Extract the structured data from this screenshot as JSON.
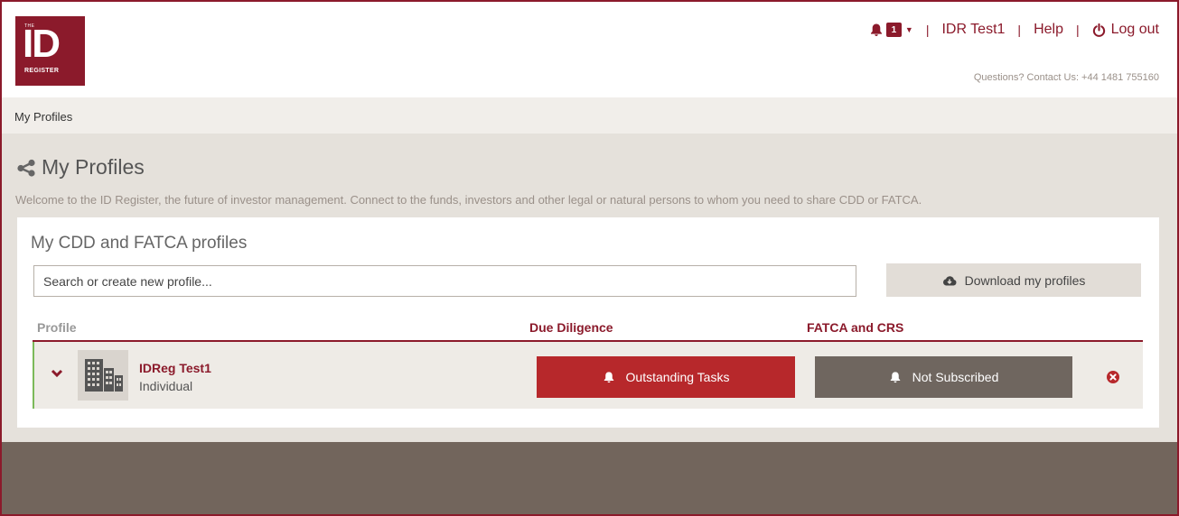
{
  "logo": {
    "the": "THE",
    "id": "ID",
    "register": "REGISTER"
  },
  "topnav": {
    "notification_count": "1",
    "user": "IDR Test1",
    "help": "Help",
    "logout": "Log out",
    "separator": "|"
  },
  "contact": "Questions? Contact Us: +44 1481 755160",
  "breadcrumb": "My Profiles",
  "page": {
    "title": "My Profiles",
    "welcome": "Welcome to the ID Register, the future of investor management. Connect to the funds, investors and other legal or natural persons to whom you need to share CDD or FATCA."
  },
  "card": {
    "title": "My CDD and FATCA profiles",
    "search_placeholder": "Search or create new profile...",
    "download_label": "Download my profiles",
    "columns": {
      "profile": "Profile",
      "due_diligence": "Due Diligence",
      "fatca": "FATCA and CRS"
    },
    "rows": [
      {
        "name": "IDReg Test1",
        "type": "Individual",
        "due_diligence_status": "Outstanding Tasks",
        "fatca_status": "Not Subscribed"
      }
    ]
  },
  "colors": {
    "brand": "#8b1a2b",
    "danger": "#b7282b",
    "neutral_button": "#6f665f",
    "footer": "#72655c",
    "row_accent": "#7cba5a"
  },
  "icons": {
    "notification": "bell-icon",
    "logout": "power-icon",
    "title": "share-icon",
    "download": "cloud-download-icon",
    "expand": "chevron-down-icon",
    "avatar": "building-icon",
    "status": "bell-icon",
    "remove": "close-circle-icon"
  }
}
